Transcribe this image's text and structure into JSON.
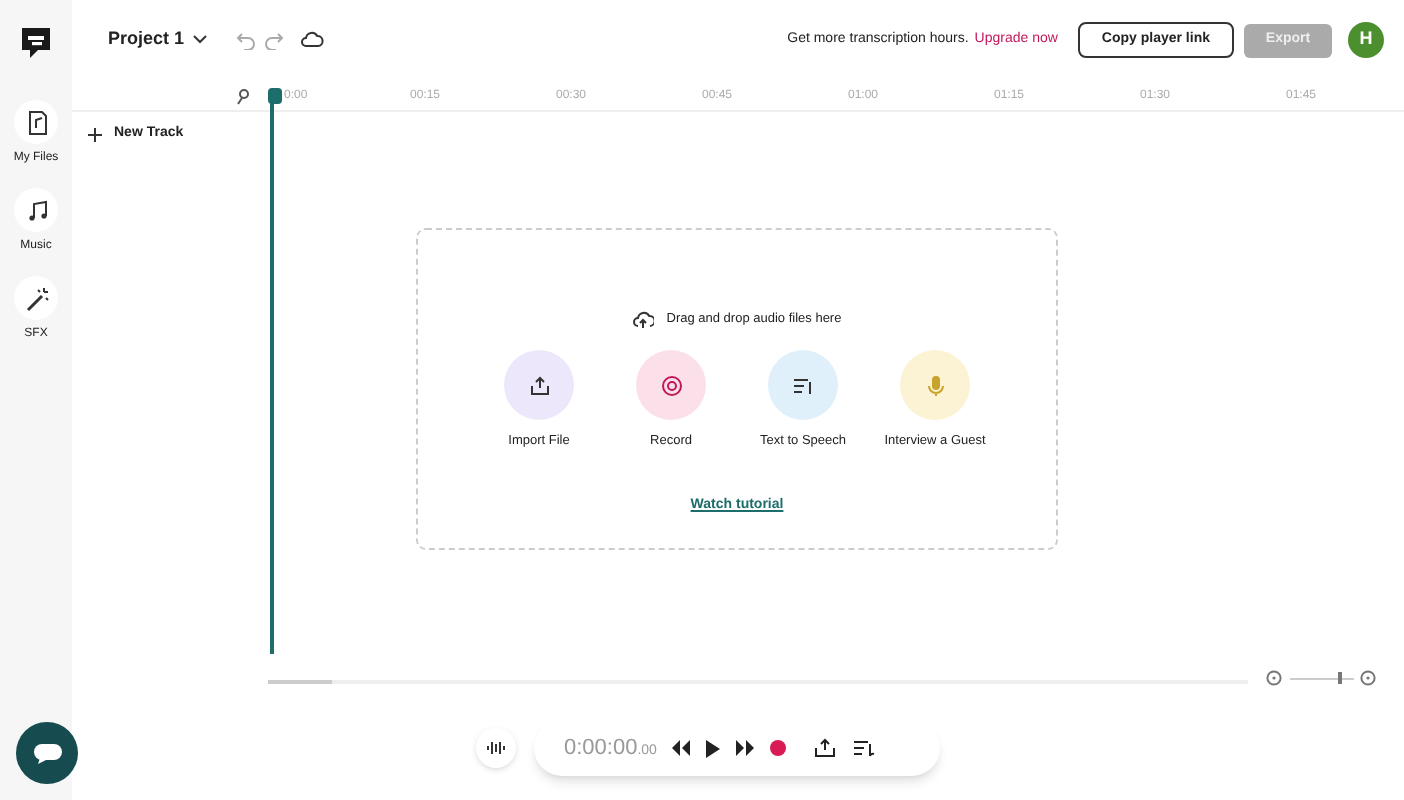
{
  "sidebar": {
    "items": [
      {
        "label": "My Files",
        "kind": "file"
      },
      {
        "label": "Music",
        "kind": "music"
      },
      {
        "label": "SFX",
        "kind": "wand"
      }
    ]
  },
  "header": {
    "project": "Project 1",
    "promo": "Get more transcription hours.",
    "upgrade": "Upgrade now",
    "copy_button": "Copy player link",
    "export_button": {
      "label": "Export",
      "disabled": true
    },
    "avatar": "H"
  },
  "ruler": {
    "ticks": [
      "0:00",
      "00:15",
      "00:30",
      "00:45",
      "01:00",
      "01:15",
      "01:30",
      "01:45"
    ]
  },
  "tracks": {
    "new_track": "New Track"
  },
  "dropzone": {
    "hint": "Drag and drop audio files here",
    "actions": [
      {
        "label": "Import File",
        "kind": "upload",
        "color": "#ede7fb"
      },
      {
        "label": "Record",
        "kind": "record",
        "color": "#fbe0e9"
      },
      {
        "label": "Text to Speech",
        "kind": "tts",
        "color": "#e0f0fb"
      },
      {
        "label": "Interview a Guest",
        "kind": "mic",
        "color": "#fbf3d3"
      }
    ],
    "tutorial": "Watch tutorial"
  },
  "zoom": {
    "level": 0.8
  },
  "player": {
    "time": "0:00:00",
    "fraction": ".00"
  }
}
